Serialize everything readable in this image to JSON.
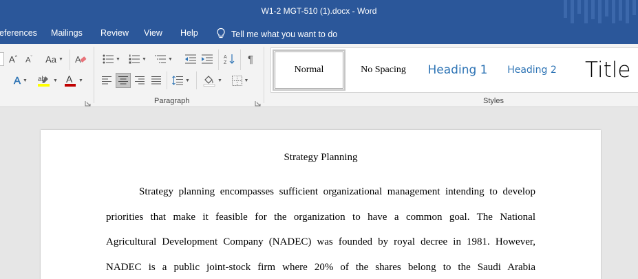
{
  "window": {
    "title": "W1-2 MGT-510 (1).docx  -  Word"
  },
  "menu": {
    "references": "eferences",
    "mailings": "Mailings",
    "review": "Review",
    "view": "View",
    "help": "Help",
    "tell_me": "Tell me what you want to do"
  },
  "ribbon": {
    "font": {
      "change_case": "Aa"
    },
    "paragraph_label": "Paragraph",
    "styles_label": "Styles",
    "styles": [
      {
        "label": "Normal",
        "selected": true
      },
      {
        "label": "No Spacing",
        "selected": false
      },
      {
        "label": "Heading 1",
        "selected": false
      },
      {
        "label": "Heading 2",
        "selected": false
      },
      {
        "label": "Title",
        "selected": false
      }
    ],
    "colors": {
      "highlight": "#ffff00",
      "font_color": "#c00000",
      "accent": "#2b579a",
      "heading": "#2e74b5"
    }
  },
  "document": {
    "title": "Strategy Planning",
    "lines": [
      "Strategy planning encompasses sufficient organizational management intending to develop",
      "priorities that make it feasible for the organization to have a common goal. The National",
      "Agricultural Development Company (NADEC) was founded by royal decree in 1981. However,",
      "NADEC is a public joint-stock firm where 20% of the shares belong to the Saudi Arabia"
    ]
  }
}
